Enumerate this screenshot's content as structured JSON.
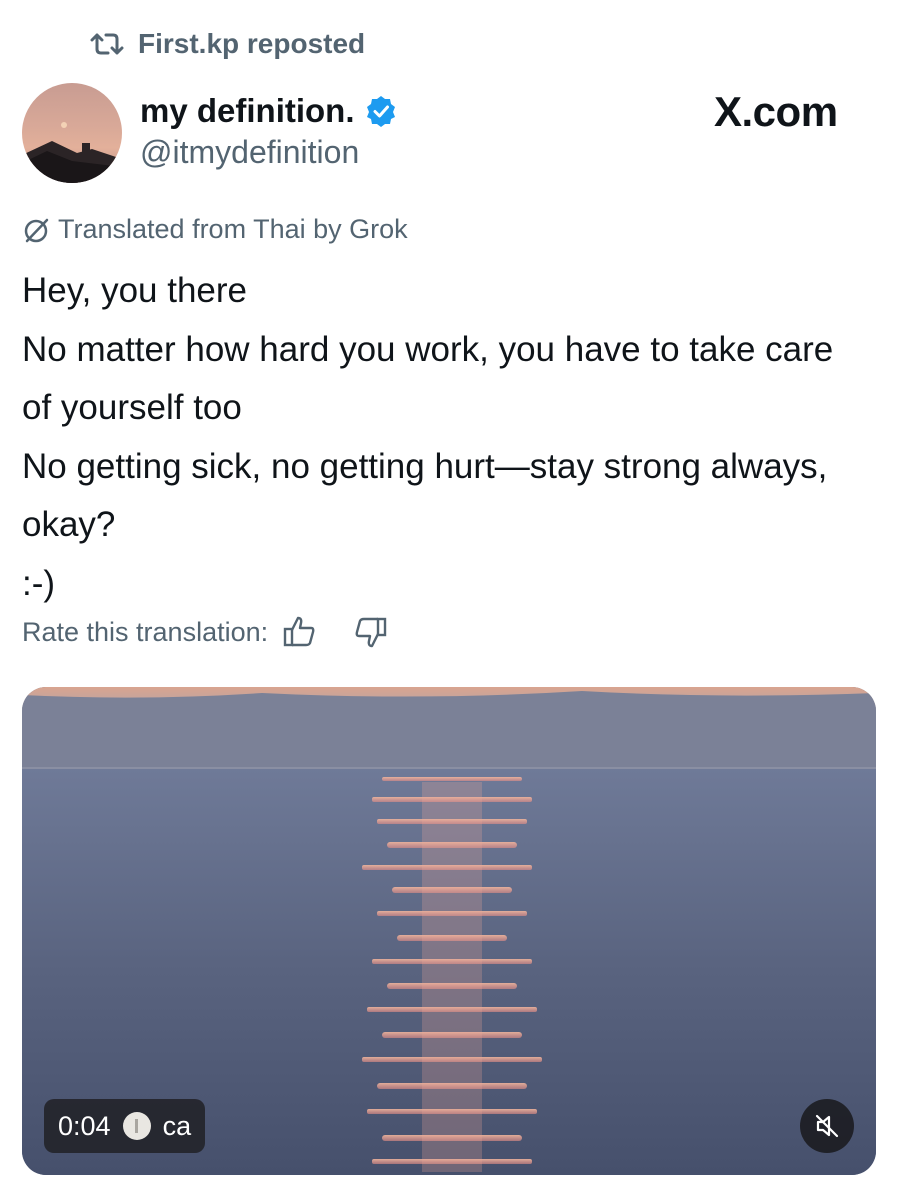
{
  "repost": {
    "icon": "repost-icon",
    "text": "First.kp reposted"
  },
  "author": {
    "display_name": "my definition.",
    "handle": "@itmydefinition",
    "verified": true,
    "verified_color": "#1d9bf0"
  },
  "watermark": "X.com",
  "translation": {
    "icon": "grok-icon",
    "label": "Translated from Thai by Grok",
    "rate_label": "Rate this translation:",
    "thumbs_up_icon": "thumbs-up-icon",
    "thumbs_down_icon": "thumbs-down-icon"
  },
  "post": {
    "lines": [
      "Hey, you there",
      "No matter how hard you work, you have to take care of yourself too",
      "No getting sick, no getting hurt—stay strong always, okay?",
      ":-)"
    ]
  },
  "video": {
    "time": "0:04",
    "caption_label": "ca",
    "mute_icon": "speaker-muted-icon"
  },
  "colors": {
    "text_primary": "#0f1419",
    "text_secondary": "#536471",
    "accent": "#1d9bf0"
  }
}
